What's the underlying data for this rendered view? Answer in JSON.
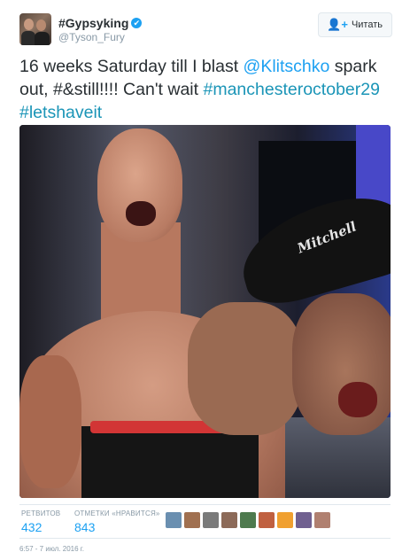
{
  "author": {
    "display_name": "#Gypsyking",
    "handle": "@Tyson_Fury",
    "verified_glyph": "✔"
  },
  "follow_button": {
    "label": "Читать",
    "icon": "add-user-icon"
  },
  "tweet": {
    "text_1": "16 weeks Saturday till I blast ",
    "mention": "@Klitschko",
    "text_2": " spark out, #&still!!!! Can't wait ",
    "hashtag_1": "#manchesteroctober29",
    "hashtag_2": "#letshaveit"
  },
  "photo": {
    "cap_text": "Mitchell"
  },
  "stats": {
    "retweets_label": "РЕТВИТОВ",
    "retweets_value": "432",
    "likes_label": "ОТМЕТКИ «НРАВИТСЯ»",
    "likes_value": "843"
  },
  "likers_colors": [
    "#6a8fb0",
    "#a07050",
    "#7a7a7a",
    "#8c6a58",
    "#4e7a4e",
    "#c06040",
    "#f0a030",
    "#706090",
    "#b08070"
  ],
  "timestamp": "6:57 - 7 июл. 2016 г.",
  "colors": {
    "link": "#1da1f2",
    "muted": "#8899a6",
    "text": "#292f33"
  }
}
